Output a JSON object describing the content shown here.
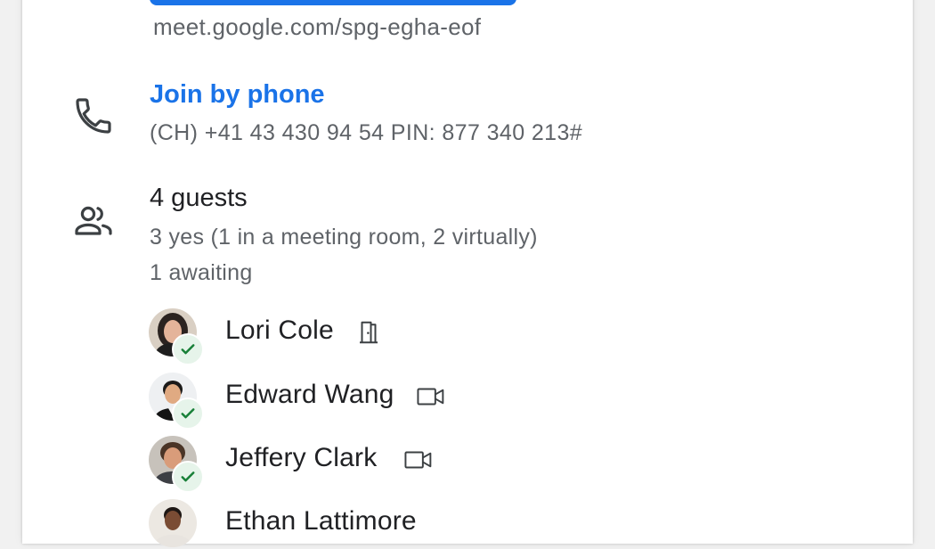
{
  "meeting": {
    "link": "meet.google.com/spg-egha-eof"
  },
  "phone": {
    "title": "Join by phone",
    "number": "(CH) +41 43 430 94 54 PIN: 877 340 213#",
    "icon": "phone-icon"
  },
  "guests": {
    "title": "4 guests",
    "yes_summary": "3 yes (1 in a meeting room, 2 virtually)",
    "awaiting_summary": "1 awaiting",
    "icon": "people-icon",
    "list": [
      {
        "name": "Lori Cole",
        "status": "accepted",
        "attendance": "meeting-room-icon"
      },
      {
        "name": "Edward Wang",
        "status": "accepted",
        "attendance": "video-camera-icon"
      },
      {
        "name": "Jeffery Clark",
        "status": "accepted",
        "attendance": "video-camera-icon"
      },
      {
        "name": "Ethan Lattimore",
        "status": "awaiting",
        "attendance": ""
      }
    ]
  },
  "colors": {
    "accent": "#1a73e8",
    "secondary_text": "#5f6368",
    "accepted_badge": "#e6f4ea",
    "accepted_check": "#188038"
  }
}
